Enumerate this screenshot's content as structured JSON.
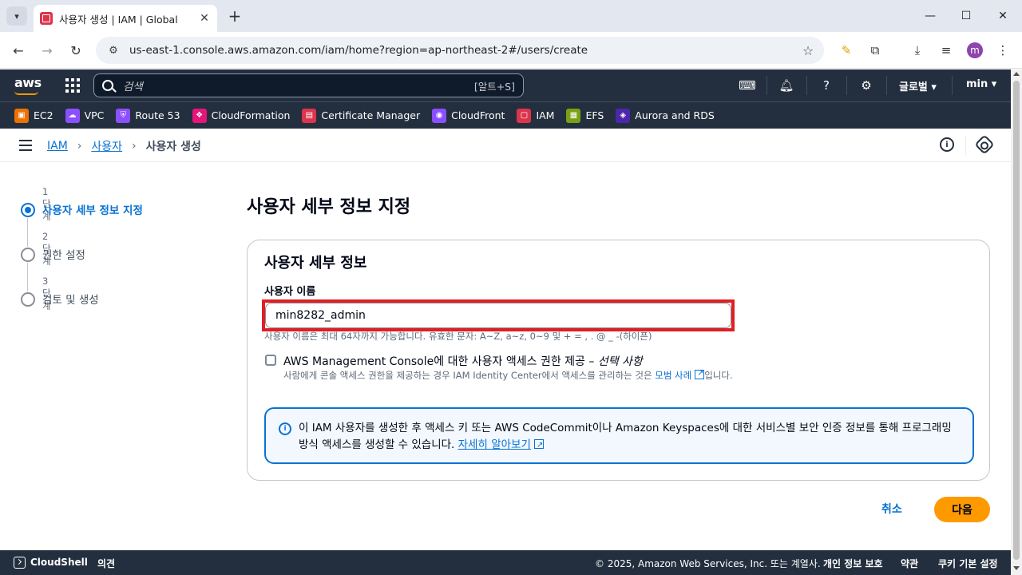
{
  "browser": {
    "tab_title": "사용자 생성 | IAM | Global",
    "url": "us-east-1.console.aws.amazon.com/iam/home?region=ap-northeast-2#/users/create",
    "profile_initial": "m"
  },
  "aws_nav": {
    "logo": "aws",
    "search_placeholder": "검색",
    "search_shortcut": "[알트+S]",
    "region": "글로벌 ▾",
    "user": "min ▾"
  },
  "favorites": [
    {
      "label": "EC2",
      "color": "#ed7100"
    },
    {
      "label": "VPC",
      "color": "#8c4fff"
    },
    {
      "label": "Route 53",
      "color": "#8c4fff"
    },
    {
      "label": "CloudFormation",
      "color": "#e7157b"
    },
    {
      "label": "Certificate Manager",
      "color": "#dd344c"
    },
    {
      "label": "CloudFront",
      "color": "#8c4fff"
    },
    {
      "label": "IAM",
      "color": "#dd344c"
    },
    {
      "label": "EFS",
      "color": "#7aa116"
    },
    {
      "label": "Aurora and RDS",
      "color": "#4d27aa"
    }
  ],
  "breadcrumb": {
    "items": [
      "IAM",
      "사용자"
    ],
    "current": "사용자 생성"
  },
  "steps": [
    {
      "num": "1단계",
      "label": "사용자 세부 정보 지정",
      "active": true
    },
    {
      "num": "2단계",
      "label": "권한 설정",
      "active": false
    },
    {
      "num": "3단계",
      "label": "검토 및 생성",
      "active": false
    }
  ],
  "main": {
    "page_title": "사용자 세부 정보 지정",
    "panel_title": "사용자 세부 정보",
    "username_label": "사용자 이름",
    "username_value": "min8282_admin",
    "username_hint": "사용자 이름은 최대 64자까지 가능합니다. 유효한 문자: A~Z, a~z, 0~9 및 + = , . @ _ -(하이픈)",
    "console_access_label": "AWS Management Console에 대한 사용자 액세스 권한 제공 – ",
    "console_access_optional": "선택 사항",
    "console_access_desc_prefix": "사람에게 콘솔 액세스 권한을 제공하는 경우 IAM Identity Center에서 액세스를 관리하는 것은 ",
    "console_access_desc_link": "모범 사례",
    "console_access_desc_suffix": "입니다.",
    "alert_text": "이 IAM 사용자를 생성한 후 액세스 키 또는 AWS CodeCommit이나 Amazon Keyspaces에 대한 서비스별 보안 인증 정보를 통해 프로그래밍 방식 액세스를 생성할 수 있습니다. ",
    "alert_link": "자세히 알아보기",
    "cancel_label": "취소",
    "next_label": "다음"
  },
  "footer": {
    "cloudshell": "CloudShell",
    "feedback": "의견",
    "copyright": "© 2025, Amazon Web Services, Inc. 또는 계열사.",
    "privacy": "개인 정보 보호",
    "terms": "약관",
    "cookies": "쿠키 기본 설정"
  }
}
